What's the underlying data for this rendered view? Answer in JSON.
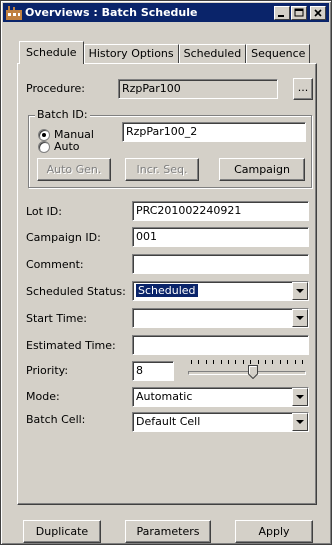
{
  "window": {
    "title": "Overviews : Batch Schedule"
  },
  "tabs": [
    {
      "label": "Schedule",
      "active": true
    },
    {
      "label": "History Options",
      "active": false
    },
    {
      "label": "Scheduled",
      "active": false
    },
    {
      "label": "Sequence",
      "active": false
    }
  ],
  "procedure": {
    "label": "Procedure:",
    "value": "RzpPar100",
    "browse_label": "..."
  },
  "batch_id": {
    "group_title": "Batch ID:",
    "manual_label": "Manual",
    "auto_label": "Auto",
    "selected": "Manual",
    "value": "RzpPar100_2",
    "auto_gen_label": "Auto Gen.",
    "incr_seq_label": "Incr. Seq.",
    "campaign_label": "Campaign"
  },
  "fields": {
    "lot_id": {
      "label": "Lot ID:",
      "value": "PRC201002240921"
    },
    "campaign_id": {
      "label": "Campaign ID:",
      "value": "001"
    },
    "comment": {
      "label": "Comment:",
      "value": ""
    },
    "scheduled_status": {
      "label": "Scheduled Status:",
      "value": "Scheduled"
    },
    "start_time": {
      "label": "Start Time:",
      "value": ""
    },
    "estimated_time": {
      "label": "Estimated Time:",
      "value": ""
    },
    "priority": {
      "label": "Priority:",
      "value": "8",
      "slider_level": 0.55,
      "tick_count": 16
    },
    "mode": {
      "label": "Mode:",
      "value": "Automatic"
    },
    "batch_cell": {
      "label": "Batch Cell:",
      "value": "Default Cell"
    }
  },
  "footer": {
    "duplicate_label": "Duplicate",
    "parameters_label": "Parameters",
    "apply_label": "Apply"
  },
  "colors": {
    "title_bar": "#0a246a",
    "face": "#d4d0c8",
    "selection": "#0a246a"
  }
}
